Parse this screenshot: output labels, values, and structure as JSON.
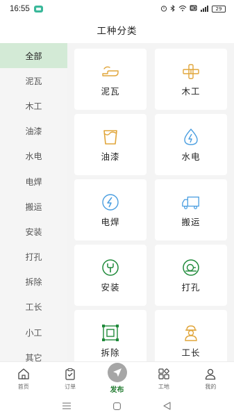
{
  "status_bar": {
    "time": "16:55",
    "battery": "29"
  },
  "header": {
    "title": "工种分类"
  },
  "sidebar": {
    "items": [
      {
        "label": "全部",
        "active": true
      },
      {
        "label": "泥瓦"
      },
      {
        "label": "木工"
      },
      {
        "label": "油漆"
      },
      {
        "label": "水电"
      },
      {
        "label": "电焊"
      },
      {
        "label": "搬运"
      },
      {
        "label": "安装"
      },
      {
        "label": "打孔"
      },
      {
        "label": "拆除"
      },
      {
        "label": "工长"
      },
      {
        "label": "小工"
      },
      {
        "label": "其它"
      }
    ]
  },
  "grid": {
    "items": [
      {
        "label": "泥瓦",
        "icon": "trowel-icon",
        "color": "#e0a53a"
      },
      {
        "label": "木工",
        "icon": "saw-icon",
        "color": "#e0a53a"
      },
      {
        "label": "油漆",
        "icon": "paint-bucket-icon",
        "color": "#e0a53a"
      },
      {
        "label": "水电",
        "icon": "water-electric-icon",
        "color": "#4a9ee0"
      },
      {
        "label": "电焊",
        "icon": "lightning-icon",
        "color": "#4a9ee0"
      },
      {
        "label": "搬运",
        "icon": "truck-icon",
        "color": "#4a9ee0"
      },
      {
        "label": "安装",
        "icon": "wrench-icon",
        "color": "#1f8a3a"
      },
      {
        "label": "打孔",
        "icon": "drill-icon",
        "color": "#1f8a3a"
      },
      {
        "label": "拆除",
        "icon": "demolish-icon",
        "color": "#1f8a3a"
      },
      {
        "label": "工长",
        "icon": "foreman-icon",
        "color": "#e0a53a"
      }
    ]
  },
  "bottom_nav": {
    "items": [
      {
        "label": "首页",
        "icon": "home-icon"
      },
      {
        "label": "订单",
        "icon": "clipboard-icon"
      },
      {
        "label": "发布",
        "icon": "send-icon",
        "active": true
      },
      {
        "label": "工地",
        "icon": "apps-icon"
      },
      {
        "label": "我的",
        "icon": "user-icon"
      }
    ]
  },
  "colors": {
    "accent": "#1f7a2e",
    "sidebar_active_bg": "#d3ead6",
    "sidebar_bg": "#f5f5f5",
    "grid_bg": "#f4f4f4"
  }
}
